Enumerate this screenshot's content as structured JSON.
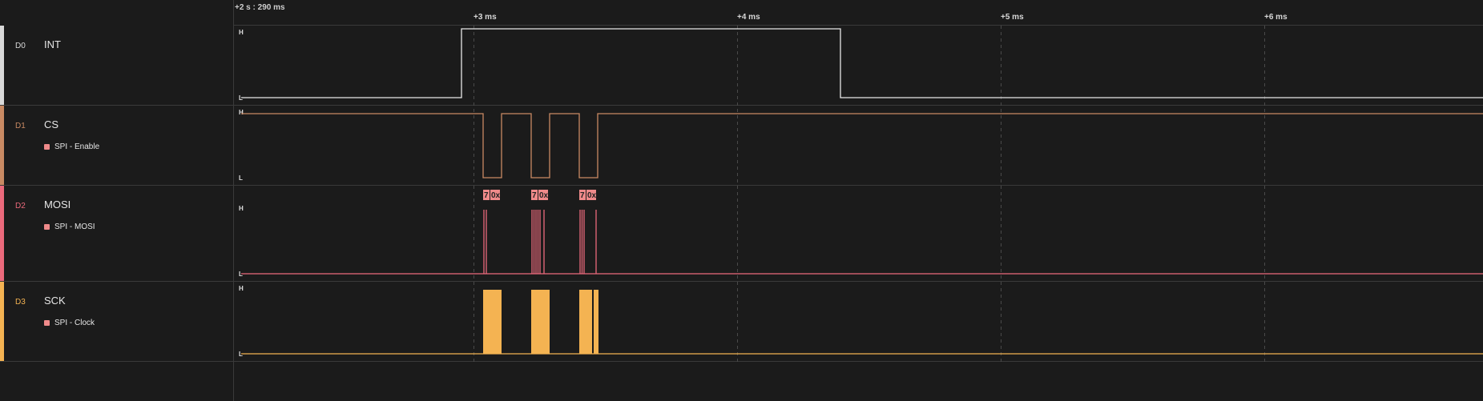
{
  "timeline": {
    "offset_label": "+2 s : 290 ms",
    "ticks": [
      "+3 ms",
      "+4 ms",
      "+5 ms",
      "+6 ms"
    ]
  },
  "channels": [
    {
      "id": "D0",
      "name": "INT",
      "color": "#d9d9d9",
      "analyzer": ""
    },
    {
      "id": "D1",
      "name": "CS",
      "color": "#c98a63",
      "analyzer": "SPI - Enable"
    },
    {
      "id": "D2",
      "name": "MOSI",
      "color": "#ec6a7c",
      "analyzer": "SPI - MOSI"
    },
    {
      "id": "D3",
      "name": "SCK",
      "color": "#f4b352",
      "analyzer": "SPI - Clock"
    }
  ],
  "level_labels": {
    "high": "H",
    "low": "L"
  },
  "decoded_bytes": [
    "7",
    "0x",
    "7",
    "0x",
    "7",
    "0x"
  ],
  "colors": {
    "background": "#1b1b1b",
    "grid": "#444444",
    "analyzer_badge": "#ef8a8a"
  }
}
